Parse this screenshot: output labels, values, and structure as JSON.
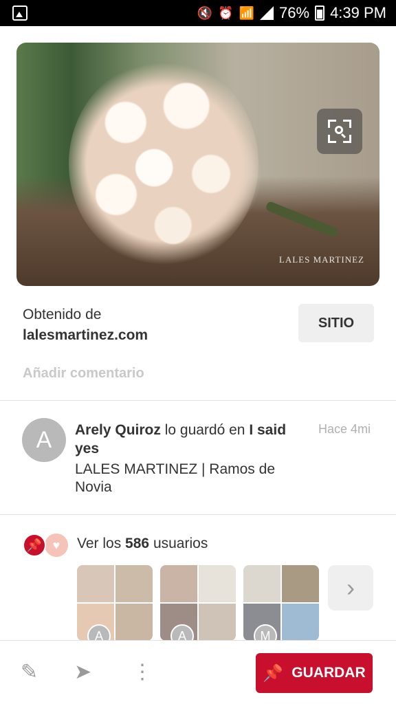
{
  "status_bar": {
    "battery": "76%",
    "time": "4:39 PM"
  },
  "pin": {
    "image_alt": "Ramo de novia blanco",
    "watermark": "LALES MARTINEZ"
  },
  "source": {
    "label": "Obtenido de",
    "domain": "lalesmartinez.com",
    "site_button": "SITIO"
  },
  "comment": {
    "placeholder": "Añadir comentario"
  },
  "activity": {
    "avatar_letter": "A",
    "user": "Arely Quiroz",
    "verb": "lo guardó en",
    "board": "I said yes",
    "time": "Hace 4mi",
    "title": "LALES MARTINEZ | Ramos de Novia"
  },
  "savers": {
    "prefix": "Ver los",
    "count": "586",
    "suffix": "usuarios",
    "boards": [
      {
        "avatar": "A",
        "colors": [
          "#d8c7b8",
          "#cdbba9",
          "#e6c9b2",
          "#c9b7a3"
        ]
      },
      {
        "avatar": "A",
        "colors": [
          "#c9b4a6",
          "#e7e2da",
          "#9d8d86",
          "#cfc2b7"
        ]
      },
      {
        "avatar": "M",
        "colors": [
          "#dcd8cf",
          "#a99a84",
          "#8b8d92",
          "#9fbad3"
        ]
      }
    ]
  },
  "toolbar": {
    "save_label": "GUARDAR"
  },
  "colors": {
    "brand_red": "#c8102e"
  }
}
